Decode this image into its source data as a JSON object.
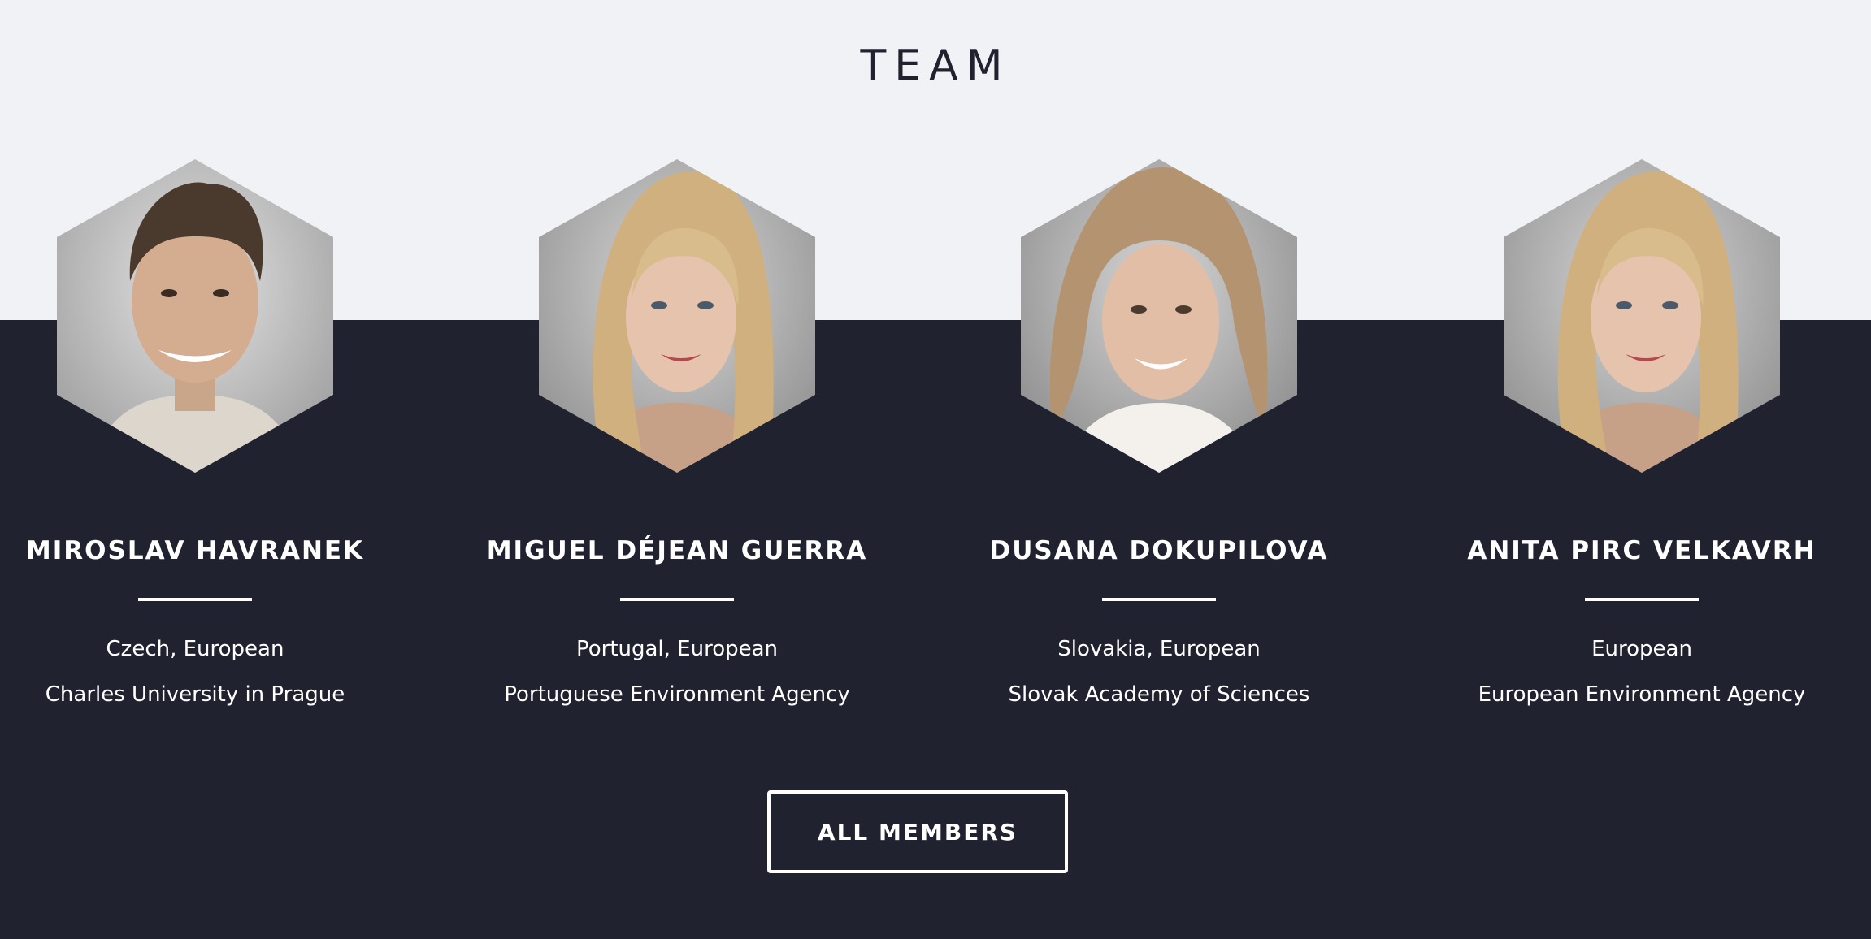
{
  "section": {
    "title": "TEAM"
  },
  "members": [
    {
      "name": "MIROSLAV HAVRANEK",
      "country": "Czech, European",
      "organization": "Charles University in Prague",
      "photo": "portrait-man-smiling"
    },
    {
      "name": "MIGUEL DÉJEAN GUERRA",
      "country": "Portugal, European",
      "organization": "Portuguese Environment Agency",
      "photo": "portrait-blonde-woman"
    },
    {
      "name": "DUSANA DOKUPILOVA",
      "country": "Slovakia, European",
      "organization": "Slovak Academy of Sciences",
      "photo": "portrait-woman-wavy-hair"
    },
    {
      "name": "ANITA PIRC VELKAVRH",
      "country": "European",
      "organization": "European Environment Agency",
      "photo": "portrait-blonde-woman"
    }
  ],
  "button": {
    "label": "ALL MEMBERS"
  },
  "colors": {
    "light_background": "#f1f2f5",
    "dark_background": "#212230",
    "text_light": "#ffffff",
    "text_dark": "#212230"
  }
}
